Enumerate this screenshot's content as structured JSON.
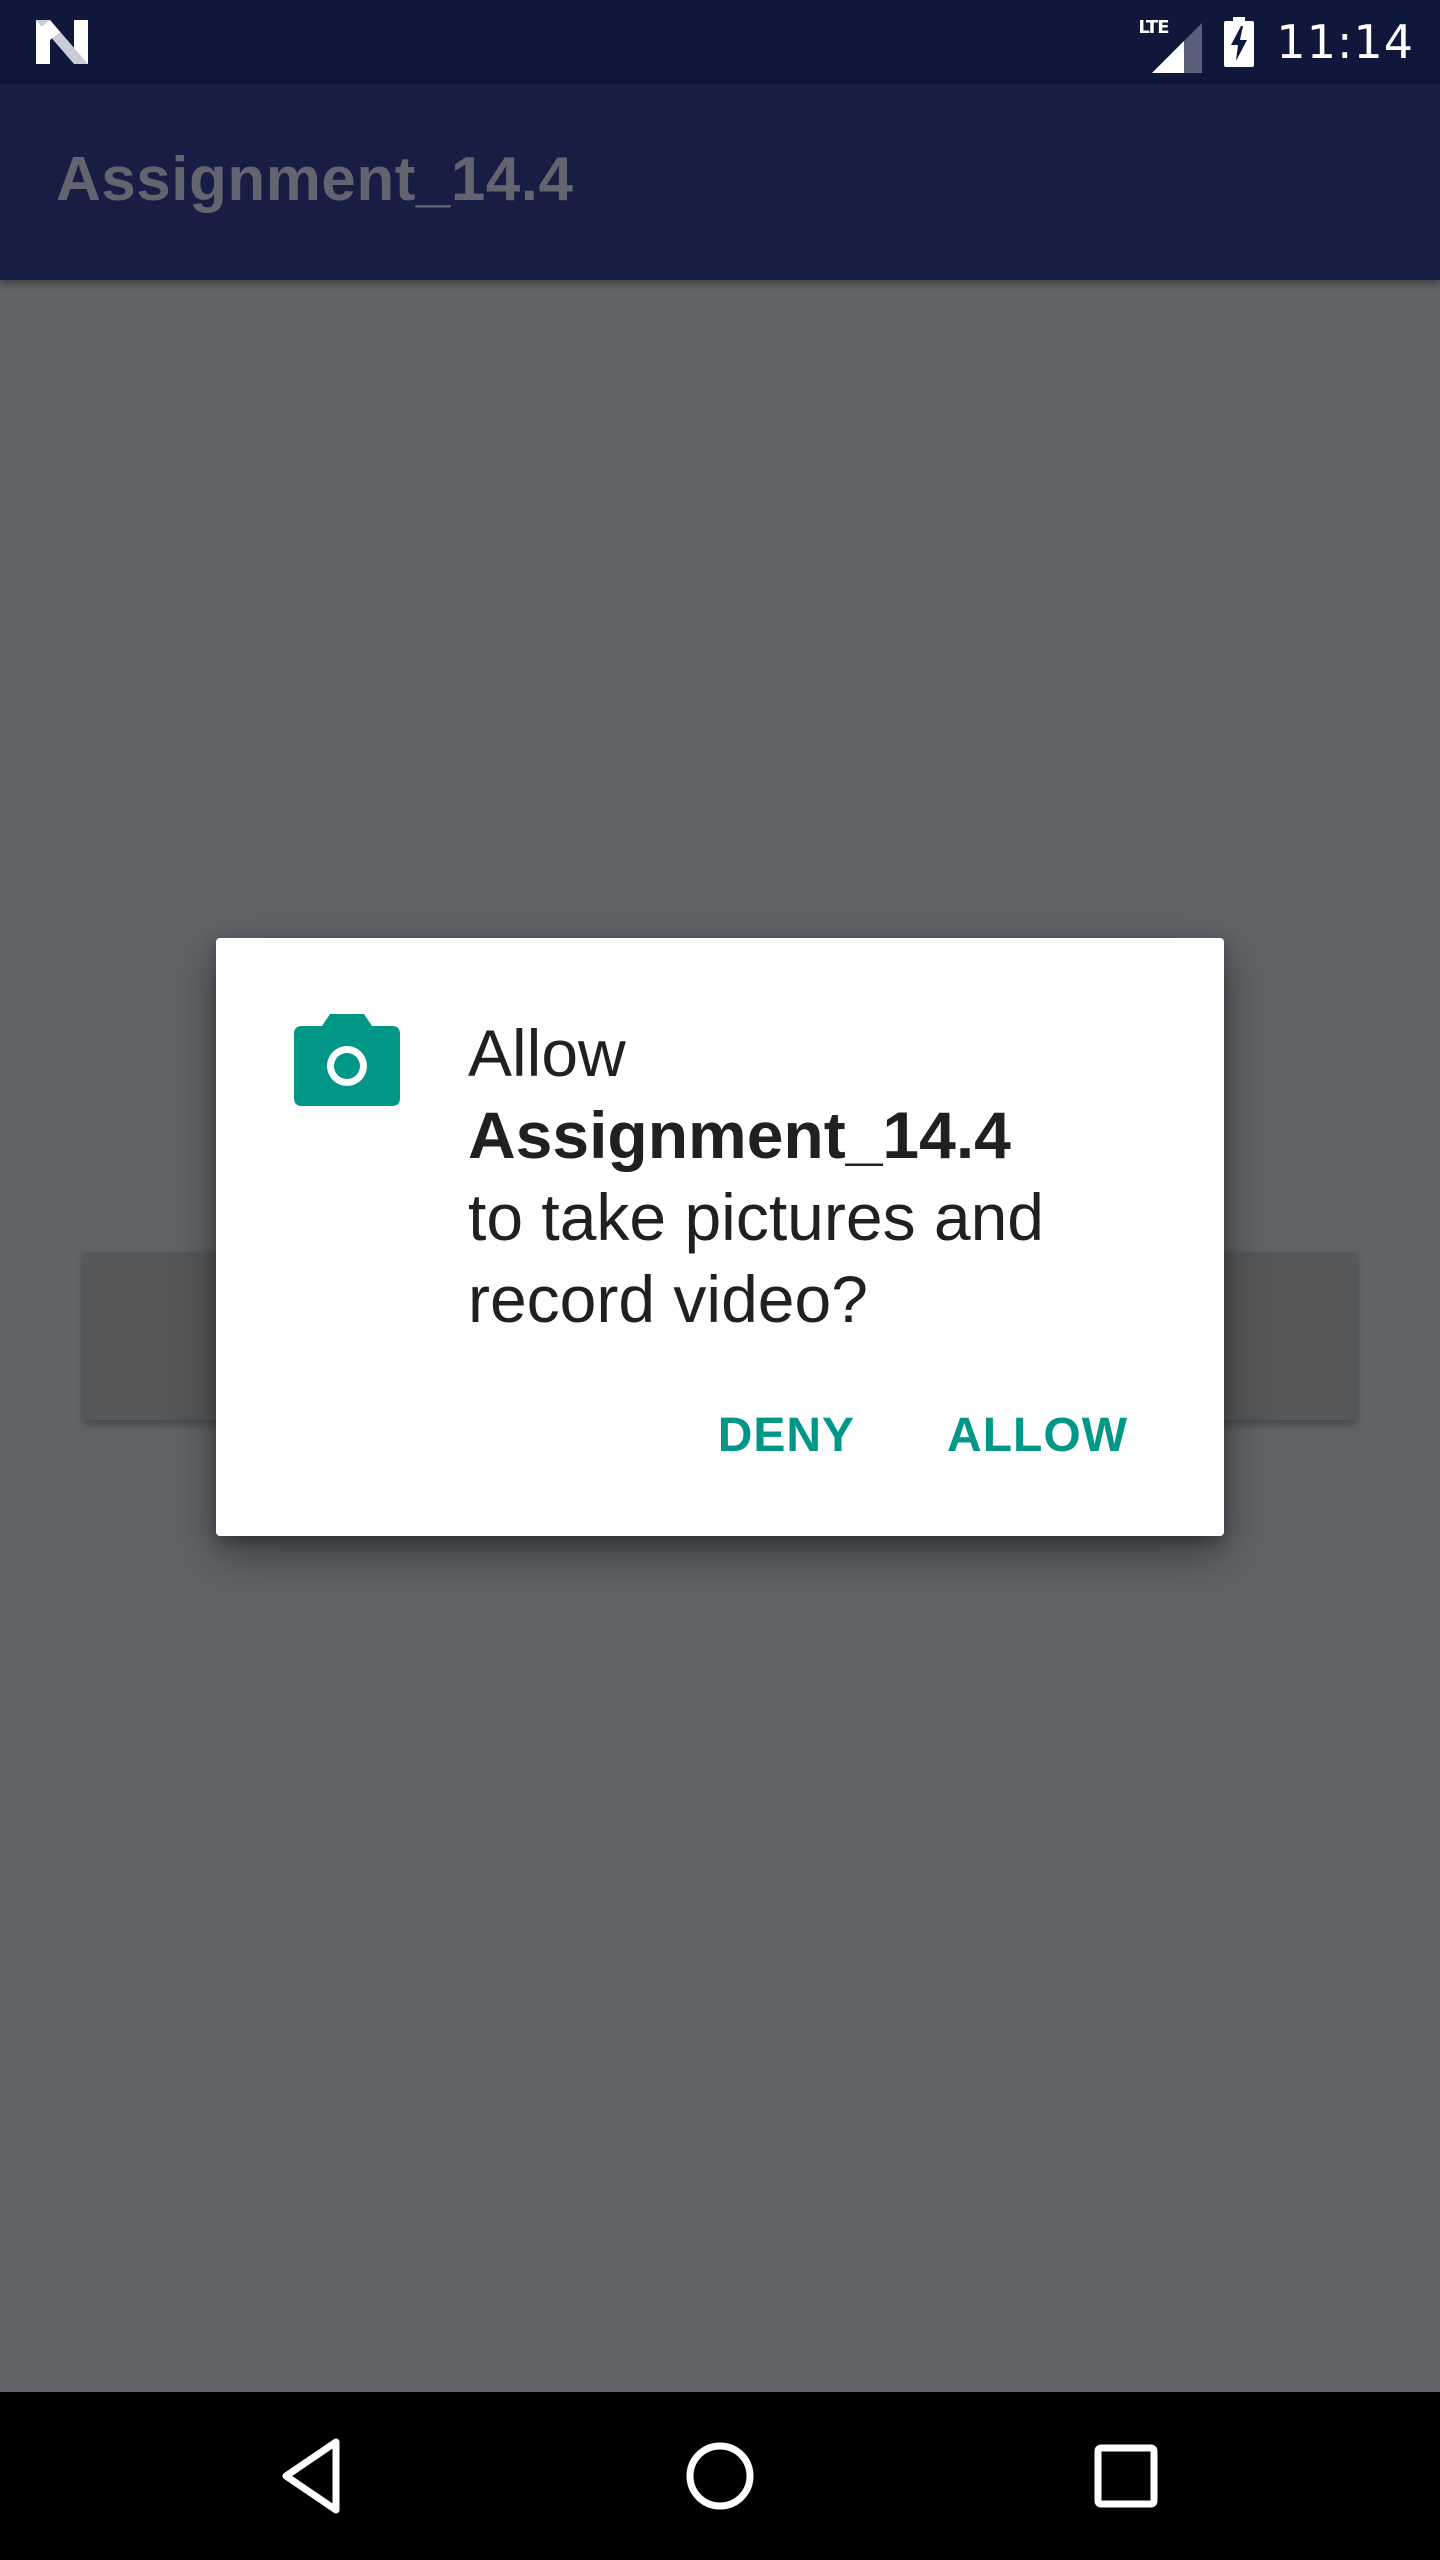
{
  "status_bar": {
    "network_label": "LTE",
    "time": "11:14",
    "left_icon": "n-logo-icon",
    "signal_icon": "signal-icon",
    "battery_icon": "battery-charging-icon"
  },
  "app_bar": {
    "title": "Assignment_14.4"
  },
  "dialog": {
    "icon": "camera-icon",
    "message_prefix": "Allow",
    "app_name": "Assignment_14.4",
    "message_line1": "to take pictures and",
    "message_line2": "record video?",
    "deny_label": "DENY",
    "allow_label": "ALLOW"
  },
  "nav_bar": {
    "back_icon": "back-icon",
    "home_icon": "home-icon",
    "recents_icon": "recents-icon"
  },
  "colors": {
    "status_bar": "#0f173a",
    "app_bar": "#181d43",
    "scrim_background": "#606468",
    "accent": "#009688"
  }
}
